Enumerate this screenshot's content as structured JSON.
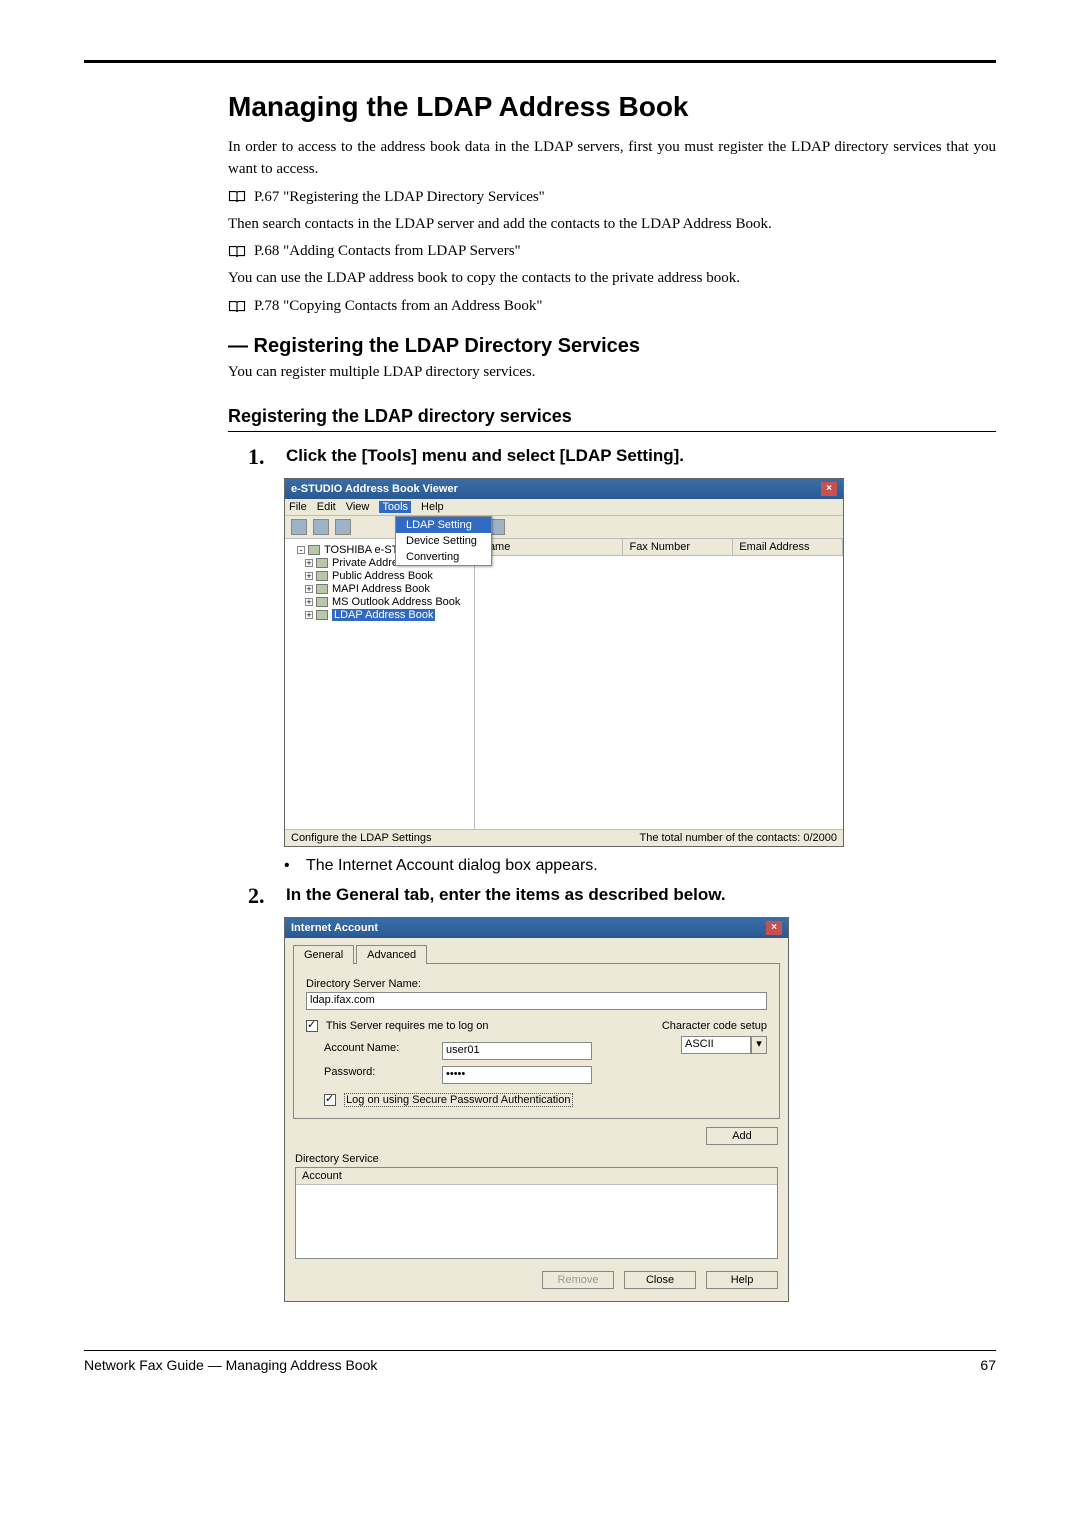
{
  "heading": "Managing the LDAP Address Book",
  "intro": "In order to access to the address book data in the LDAP servers, first you must register the LDAP directory services that you want to access.",
  "ref1": "P.67 \"Registering the LDAP Directory Services\"",
  "line2": "Then search contacts in the LDAP server and add the contacts to the LDAP Address Book.",
  "ref2": "P.68 \"Adding Contacts from LDAP Servers\"",
  "line3": "You can use the LDAP address book to copy the contacts to the private address book.",
  "ref3": "P.78 \"Copying Contacts from an Address Book\"",
  "sub_heading": "— Registering the LDAP Directory Services",
  "sub_intro": "You can register multiple LDAP directory services.",
  "proc_heading": "Registering the LDAP directory services",
  "step1_num": "1.",
  "step1_text": "Click the [Tools] menu and select [LDAP Setting].",
  "bullet1": "The Internet Account dialog box appears.",
  "step2_num": "2.",
  "step2_text": "In the General tab, enter the items as described below.",
  "win1": {
    "title": "e-STUDIO Address Book Viewer",
    "menus": {
      "file": "File",
      "edit": "Edit",
      "view": "View",
      "tools": "Tools",
      "help": "Help"
    },
    "dropdown": {
      "ldap": "LDAP Setting",
      "device": "Device Setting",
      "convert": "Converting"
    },
    "tree": {
      "root": "TOSHIBA e-STUDIO",
      "items": [
        "Private Address Book",
        "Public Address Book",
        "MAPI Address Book",
        "MS Outlook Address Book",
        "LDAP Address Book"
      ]
    },
    "columns": {
      "name": "Name",
      "fax": "Fax Number",
      "email": "Email Address"
    },
    "status_left": "Configure the LDAP Settings",
    "status_right": "The total number of the contacts: 0/2000"
  },
  "win2": {
    "title": "Internet Account",
    "tabs": {
      "general": "General",
      "advanced": "Advanced"
    },
    "dir_server_label": "Directory Server Name:",
    "dir_server_value": "ldap.ifax.com",
    "require_login": "This Server requires me to log on",
    "charset_label": "Character code setup",
    "charset_value": "ASCII",
    "account_label": "Account Name:",
    "account_value": "user01",
    "password_label": "Password:",
    "password_value": "•••••",
    "secure_auth": "Log on using Secure Password Authentication",
    "add_btn": "Add",
    "dirsvc_label": "Directory Service",
    "dirsvc_col": "Account",
    "remove_btn": "Remove",
    "close_btn": "Close",
    "help_btn": "Help"
  },
  "footer_left": "Network Fax Guide — Managing Address Book",
  "footer_right": "67"
}
